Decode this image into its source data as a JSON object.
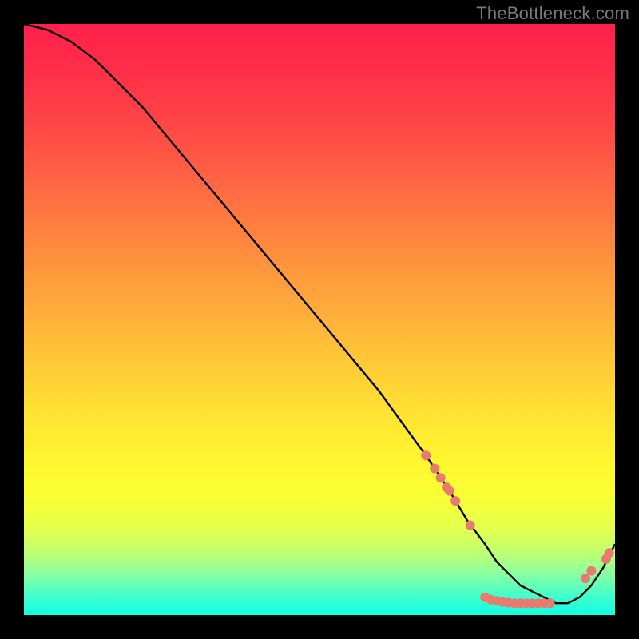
{
  "watermark": "TheBottleneck.com",
  "colors": {
    "page_bg": "#000000",
    "curve": "#000000",
    "dot": "#e87a6f",
    "watermark_text": "#7a7a7a"
  },
  "chart_data": {
    "type": "line",
    "title": "",
    "xlabel": "",
    "ylabel": "",
    "xlim": [
      0,
      100
    ],
    "ylim": [
      0,
      100
    ],
    "grid": false,
    "legend": false,
    "series": [
      {
        "name": "bottleneck-curve",
        "x": [
          0,
          4,
          8,
          12,
          20,
          30,
          40,
          50,
          60,
          68,
          72,
          75,
          78,
          80,
          82,
          84,
          86,
          88,
          90,
          92,
          94,
          96,
          98,
          100
        ],
        "values": [
          100,
          99,
          97,
          94,
          86,
          74,
          62,
          50,
          38,
          27,
          21,
          16,
          12,
          9,
          7,
          5,
          4,
          3,
          2,
          2,
          3,
          5,
          8,
          12
        ]
      }
    ],
    "markers": [
      {
        "x": 68.0,
        "y": 27.0
      },
      {
        "x": 69.5,
        "y": 24.8
      },
      {
        "x": 70.5,
        "y": 23.2
      },
      {
        "x": 71.5,
        "y": 21.6
      },
      {
        "x": 72.0,
        "y": 21.0
      },
      {
        "x": 73.0,
        "y": 19.3
      },
      {
        "x": 75.5,
        "y": 15.2
      },
      {
        "x": 78.0,
        "y": 3.0
      },
      {
        "x": 79.0,
        "y": 2.6
      },
      {
        "x": 80.0,
        "y": 2.4
      },
      {
        "x": 81.0,
        "y": 2.2
      },
      {
        "x": 82.0,
        "y": 2.1
      },
      {
        "x": 83.0,
        "y": 2.0
      },
      {
        "x": 84.0,
        "y": 2.0
      },
      {
        "x": 85.0,
        "y": 2.0
      },
      {
        "x": 86.0,
        "y": 2.0
      },
      {
        "x": 87.0,
        "y": 2.0
      },
      {
        "x": 88.0,
        "y": 2.0
      },
      {
        "x": 89.0,
        "y": 2.0
      },
      {
        "x": 95.0,
        "y": 6.2
      },
      {
        "x": 96.0,
        "y": 7.5
      },
      {
        "x": 98.5,
        "y": 9.5
      },
      {
        "x": 99.0,
        "y": 10.5
      }
    ]
  }
}
